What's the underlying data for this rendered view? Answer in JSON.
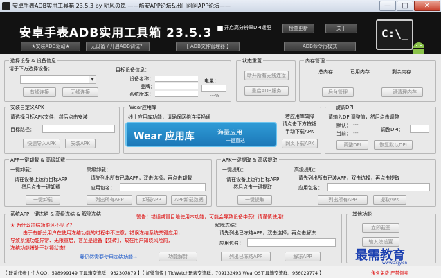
{
  "window": {
    "title": "安卓手表ADB实用工具箱    23.5.3    by 明风の岚    ——酷安APP论坛&出门问问APP论坛——",
    "minimize": "—",
    "maximize": "□",
    "close": "✕"
  },
  "header": {
    "app_title": "安卓手表ADB实用工具箱    23.5.3",
    "dpi_checkbox_label": "开启高分辨率DPI适配",
    "check_update": "检查更新",
    "about": "关于",
    "nav": [
      "★安装ADB驱动★",
      "无设备 / 开启ADB调试？",
      "【 ADB文件管理器 】",
      "ADB命令行模式"
    ],
    "logo_text": "C:\\_"
  },
  "select_device": {
    "title": "选择设备 & 设备信息",
    "prompt": "请于下方选择设备：",
    "device_selected": "",
    "connect": "有线连接",
    "wireless": "无线连接",
    "info_heading": "目标设备信息：",
    "device_name_label": "设备名称：",
    "brand_label": "品牌：",
    "system_version_label": "系统版本：",
    "battery_label": "电量：",
    "battery_value": "---%"
  },
  "status": {
    "title": "状态重置",
    "restart_wireless": "断开所有无线连接",
    "restart_adb": "重启ADB服务"
  },
  "memory": {
    "title": "内存管理",
    "total": "总内存",
    "used": "已用内存",
    "free": "剩余内存",
    "background": "后台管理",
    "clean": "一键清理内存"
  },
  "install_apk": {
    "title": "安装自定义APK",
    "hint": "请选择目标APK文件，然后点击安装",
    "dir_label": "目标路径：",
    "dir_value": "",
    "import": "快速导入APK",
    "install": "安装APK"
  },
  "wear_store": {
    "title": "Wear应用库",
    "hint": "线上应用库功能，请确保网络连接畅通",
    "banner_title": "Wear 应用库",
    "banner_sub1": "海量应用",
    "banner_sub2": "一键直达",
    "side_text": [
      "若应用库故障",
      "请点击下方按钮",
      "手动下载APK"
    ],
    "manual_download": "网页下载APK"
  },
  "dpi": {
    "title": "一键调DPI",
    "hint": "请输入DPI调整值，然后点击调整",
    "default_label": "默认：",
    "default_value": "---",
    "current_label": "当前：",
    "current_value": "---",
    "adjust_label": "调整DPI：",
    "adjust_btn": "调整DPI",
    "restore_btn": "恢复默认DPI"
  },
  "uninstall": {
    "title": "APP一键卸载 & 高级卸载",
    "sub": "一键卸载：",
    "hint": [
      "请在设备上运行目标APP",
      "然后点击一键卸载"
    ],
    "btn_uninstall": "一键卸载",
    "adv_title": "高级卸载：",
    "adv_hint": "请先列出所有已装APP，双击选择，再点击卸载",
    "pkg_label": "应用包名：",
    "list_btn": "列出所有APP",
    "uninstall_btn": "卸载APP",
    "uninstall_all_btn": "APP卸载数据"
  },
  "extract": {
    "title": "APK一键提取 & 高级提取",
    "sub": "一键提取：",
    "hint": [
      "请在设备上运行目标APP",
      "然后点击一键提取"
    ],
    "btn_extract": "一键提取",
    "adv_title": "高级提取：",
    "adv_hint": "请先列出所有已装APP，双击选择，再点击提取",
    "pkg_label": "应用包名：",
    "list_btn": "列出所有APP",
    "extract_btn": "提取APK"
  },
  "freeze": {
    "title": "系统APP一键冻结 & 高级冻结 & 解除冻结",
    "warning": "警告！错误或冒目地使用本功能，可能会导致设备中药！请谨慎使用！",
    "question": "★ 为什么冻结功能区不见了？",
    "explain": [
      "由于有部分用户在使用冻结功能的过程中不注意，错误冻结系统关键应用，",
      "导致系统功能异常、无限重启，甚至是设备【变砖】，故在用户知晓风险前，",
      "冻结功能将处于封锁状态！"
    ],
    "confirm": "我仍然需要使用冻结功能→",
    "unlock_btn": "功能解封",
    "unfreeze_title": "解除冻结：",
    "unfreeze_hint": "请先列出已冻结APP，双击选择，再点击解冻",
    "pkg_label": "应用包名：",
    "list_frozen": "列出已冻结APP",
    "unfreeze_btn": "解冻APP"
  },
  "other": {
    "title": "其他功能",
    "screenshot": "立即截图",
    "input_text": "输入法设置"
  },
  "footer": {
    "text": "【 联系作者 | 个人QQ：598999149  工具箱交流群：932307879 】【 加微宣传 | TicWatch玩表交流群：709132493  WearOS工具箱交流群：956029774 】",
    "promo": "永久免费 严禁倒卖"
  },
  "watermark": {
    "text": "最需教育",
    "url": "www.zxjy.cn"
  }
}
